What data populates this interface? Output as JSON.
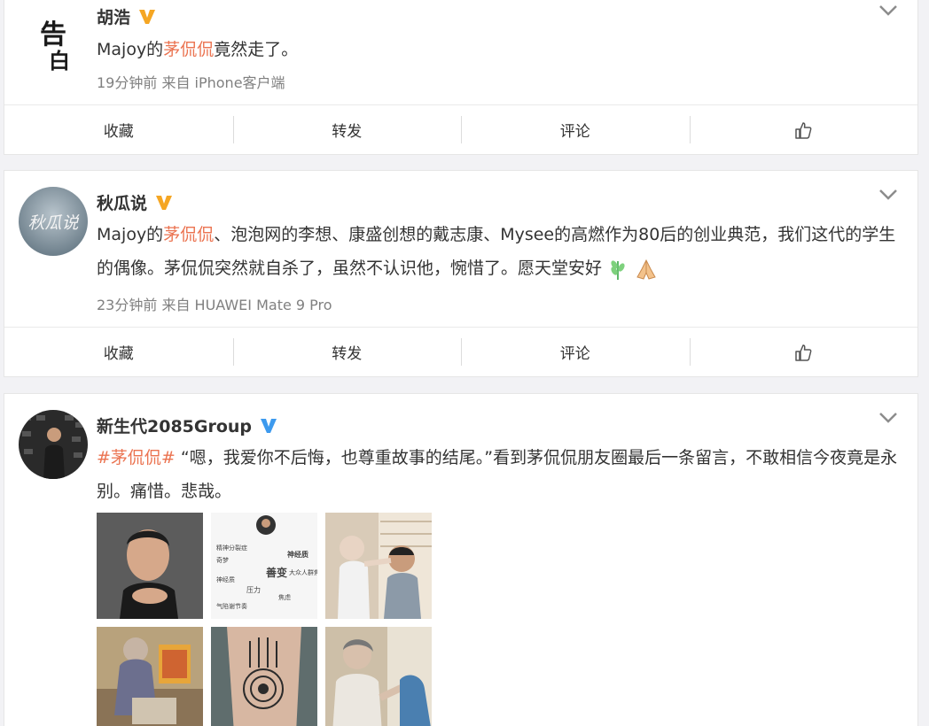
{
  "posts": [
    {
      "author": "胡浩",
      "avatar_text": "告白",
      "text_before": "Majoy的",
      "topic": "茅侃侃",
      "text_after": "竟然走了。",
      "meta": "19分钟前 来自 iPhone客户端"
    },
    {
      "author": "秋瓜说",
      "avatar_text": "秋瓜说",
      "text_before": "Majoy的",
      "topic": "茅侃侃",
      "text_after": "、泡泡网的李想、康盛创想的戴志康、Mysee的高燃作为80后的创业典范，我们这代的学生的偶像。茅侃侃突然就自杀了，虽然不认识他，惋惜了。愿天堂安好",
      "meta": "23分钟前 来自 HUAWEI Mate 9 Pro"
    },
    {
      "author": "新生代2085Group",
      "hashtag": "#茅侃侃#",
      "text_after": " “嗯，我爱你不后悔，也尊重故事的结尾。”看到茅侃侃朋友圈最后一条留言，不敢相信今夜竟是永别。痛惜。悲哉。",
      "image_words": {
        "col1": [
          "精神分裂症",
          "神经质",
          "奇梦",
          "压力",
          "焦虑",
          "气陷谢节奏"
        ],
        "col2": [
          "善变",
          "神经质",
          "大众人群焦点"
        ]
      }
    }
  ],
  "actions": {
    "favorite": "收藏",
    "repost": "转发",
    "comment": "评论"
  },
  "colors": {
    "topic": "#eb7350",
    "verified": "#f5a623",
    "verified_blue": "#3d9aee",
    "meta": "#808080"
  },
  "icons": {
    "verified": "verified-badge-icon",
    "chevron": "chevron-down-icon",
    "like": "thumbs-up-icon"
  }
}
